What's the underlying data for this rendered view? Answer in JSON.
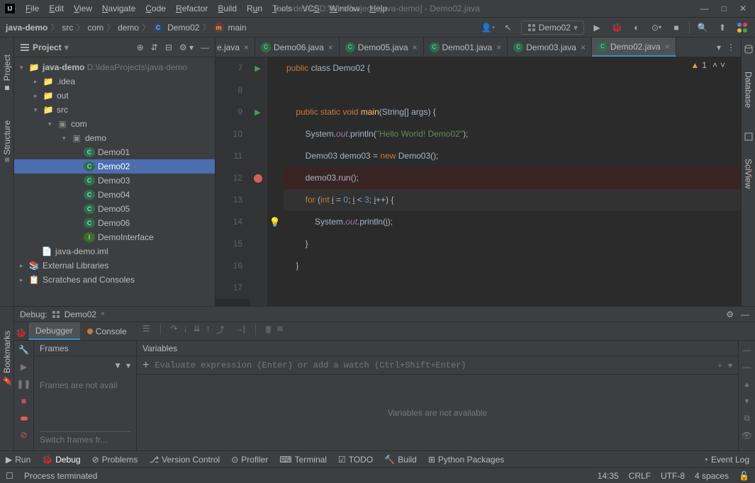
{
  "titlebar": {
    "menus": [
      "File",
      "Edit",
      "View",
      "Navigate",
      "Code",
      "Refactor",
      "Build",
      "Run",
      "Tools",
      "VCS",
      "Window",
      "Help"
    ],
    "title": "java-demo [D:\\IdeaProjects\\java-demo] - Demo02.java"
  },
  "breadcrumb": {
    "items": [
      "java-demo",
      "src",
      "com",
      "demo",
      "Demo02",
      "main"
    ]
  },
  "runConfig": {
    "name": "Demo02"
  },
  "projectPanel": {
    "title": "Project"
  },
  "tree": {
    "root": {
      "name": "java-demo",
      "path": "D:\\IdeaProjects\\java-demo"
    },
    "idea": ".idea",
    "out": "out",
    "src": "src",
    "com": "com",
    "demo": "demo",
    "classes": [
      "Demo01",
      "Demo02",
      "Demo03",
      "Demo04",
      "Demo05",
      "Demo06"
    ],
    "iface": "DemoInterface",
    "iml": "java-demo.iml",
    "extlib": "External Libraries",
    "scratch": "Scratches and Consoles"
  },
  "tabs": {
    "partial": "e.java",
    "items": [
      "Demo06.java",
      "Demo05.java",
      "Demo01.java",
      "Demo03.java",
      "Demo02.java"
    ],
    "activeIndex": 4
  },
  "warnCount": "1",
  "code": {
    "lines": [
      {
        "n": "7"
      },
      {
        "n": "8"
      },
      {
        "n": "9"
      },
      {
        "n": "10"
      },
      {
        "n": "11"
      },
      {
        "n": "12"
      },
      {
        "n": "13"
      },
      {
        "n": "14"
      },
      {
        "n": "15"
      },
      {
        "n": "16"
      },
      {
        "n": "17"
      }
    ],
    "l7a": "public",
    "l7b": " class ",
    "l7c": "Demo02",
    "l7d": " {",
    "l9a": "    public static ",
    "l9b": "void ",
    "l9c": "main",
    "l9d": "(String[] args) {",
    "l10a": "        System.",
    "l10b": "out",
    "l10c": ".println(",
    "l10d": "\"Hello World! Demo02\"",
    "l10e": ");",
    "l11a": "        Demo03 demo03 = ",
    "l11b": "new ",
    "l11c": "Demo03();",
    "l12a": "        demo03.run();",
    "l13a": "        for ",
    "l13b": "(",
    "l13c": "int ",
    "l13d": "i",
    "l13e": " = ",
    "l13f": "0",
    "l13g": "; ",
    "l13h": "i",
    "l13i": " < ",
    "l13j": "3",
    "l13k": "; ",
    "l13l": "i",
    "l13m": "++) {",
    "l14a": "            System.",
    "l14b": "out",
    "l14c": ".println(",
    "l14d": "i",
    "l14e": ");",
    "l15a": "        }",
    "l16a": "    }"
  },
  "debug": {
    "title": "Debug:",
    "cfg": "Demo02",
    "tabDebugger": "Debugger",
    "tabConsole": "Console",
    "frames": "Frames",
    "variables": "Variables",
    "framesNA": "Frames are not avail",
    "switchFrames": "Switch frames fr...",
    "varsNA": "Variables are not available",
    "evalPlaceholder": "Evaluate expression (Enter) or add a watch (Ctrl+Shift+Enter)"
  },
  "bottomTabs": {
    "run": "Run",
    "debug": "Debug",
    "problems": "Problems",
    "vcs": "Version Control",
    "profiler": "Profiler",
    "terminal": "Terminal",
    "todo": "TODO",
    "build": "Build",
    "python": "Python Packages",
    "eventlog": "Event Log"
  },
  "status": {
    "msg": "Process terminated",
    "time": "14:35",
    "lineEnd": "CRLF",
    "enc": "UTF-8",
    "indent": "4 spaces"
  },
  "leftTabs": {
    "project": "Project",
    "structure": "Structure",
    "bookmarks": "Bookmarks"
  },
  "rightTabs": {
    "database": "Database",
    "sciview": "SciView"
  }
}
